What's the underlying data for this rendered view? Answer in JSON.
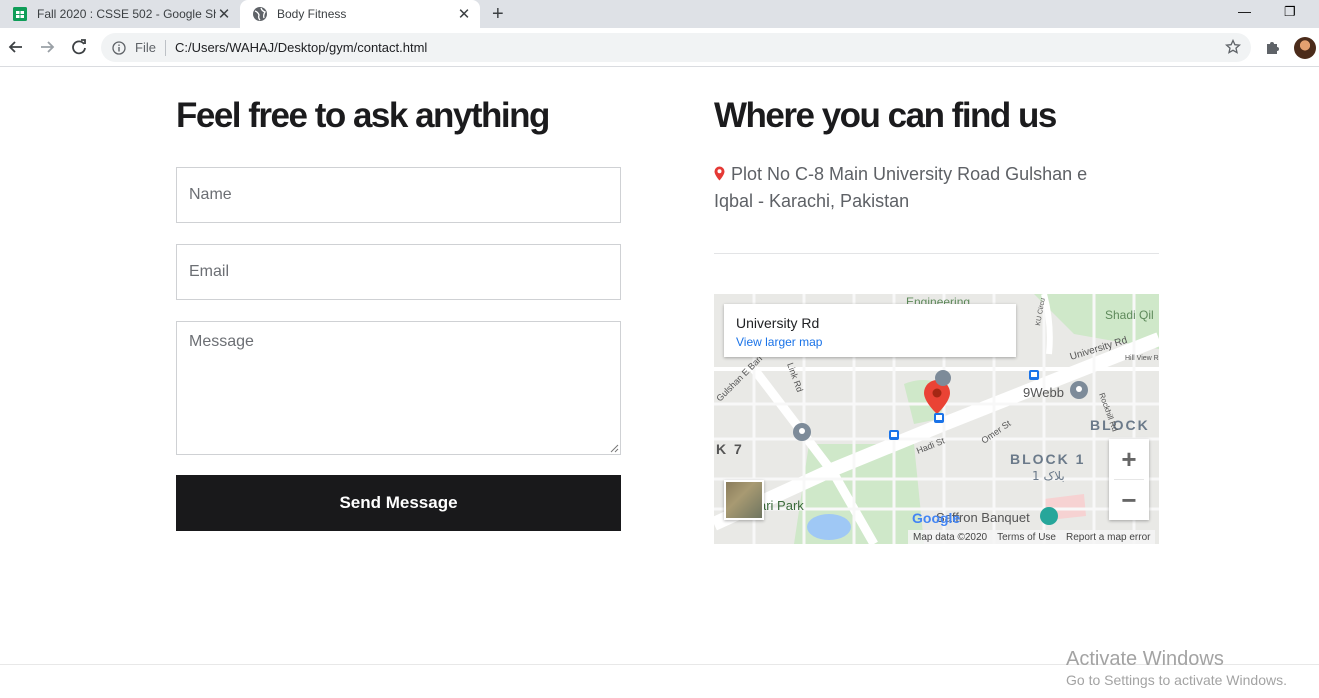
{
  "browser": {
    "tabs": [
      {
        "title": "Fall 2020 : CSSE 502 - Google She",
        "icon": "sheets-icon",
        "active": false
      },
      {
        "title": "Body Fitness",
        "icon": "globe-icon",
        "active": true
      }
    ],
    "address": {
      "scheme_label": "File",
      "url": "C:/Users/WAHAJ/Desktop/gym/contact.html"
    }
  },
  "contact": {
    "heading": "Feel free to ask anything",
    "name_placeholder": "Name",
    "email_placeholder": "Email",
    "message_placeholder": "Message",
    "send_label": "Send Message"
  },
  "location": {
    "heading": "Where you can find us",
    "address": "Plot No C-8 Main University Road Gulshan e Iqbal - Karachi, Pakistan"
  },
  "map": {
    "place_title": "University Rd",
    "larger_map_link": "View larger map",
    "labels": {
      "engineering": "Engineering",
      "university_rd": "University Rd",
      "webb": "9Webb",
      "block": "BLOCK",
      "block1": "BLOCK 1",
      "block1_urdu": "بلاک 1",
      "hadi_st": "Hadi St",
      "omer_st": "Omer St",
      "link_rd": "Link Rd",
      "gulshan_e_bari": "Gulshan E Bari",
      "shadi": "Shadi Qil",
      "k7": "K 7",
      "park": "ari Park",
      "saffron": "Saffron Banquet",
      "hill_view": "Hill View R",
      "rockhill": "Rockhill Rd",
      "ku_circ": "KU Circu"
    },
    "footer": [
      "Map data ©2020",
      "Terms of Use",
      "Report a map error"
    ],
    "google_logo": "Google"
  },
  "os_watermark": {
    "title": "Activate Windows",
    "subtitle": "Go to Settings to activate Windows."
  }
}
